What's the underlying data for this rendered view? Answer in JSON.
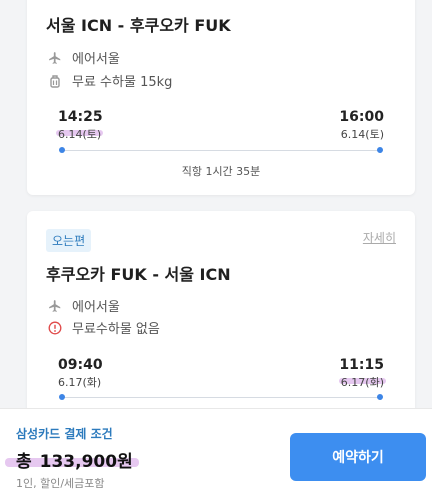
{
  "outbound": {
    "route": "서울 ICN - 후쿠오카 FUK",
    "airline": "에어서울",
    "baggage": "무료 수하물 15kg",
    "depart_time": "14:25",
    "depart_date": "6.14(토)",
    "arrive_time": "16:00",
    "arrive_date": "6.14(토)",
    "duration": "직항 1시간 35분"
  },
  "inbound": {
    "badge": "오는편",
    "detail_link": "자세히",
    "route": "후쿠오카 FUK - 서울 ICN",
    "airline": "에어서울",
    "baggage": "무료수하물 없음",
    "depart_time": "09:40",
    "depart_date": "6.17(화)",
    "arrive_time": "11:15",
    "arrive_date": "6.17(화)"
  },
  "footer": {
    "card_condition": "삼성카드 결제 조건",
    "total_label": "총",
    "total_price": "133,900원",
    "note": "1인, 할인/세금포함",
    "book_button": "예약하기"
  },
  "icons": {
    "airline": "airplane-icon",
    "baggage": "luggage-icon",
    "no_baggage": "warning-circle-icon"
  },
  "colors": {
    "accent": "#3d8ef0",
    "badge_text": "#2d7bbd",
    "highlight": "#e6c8f0",
    "warning": "#e04a4a"
  }
}
